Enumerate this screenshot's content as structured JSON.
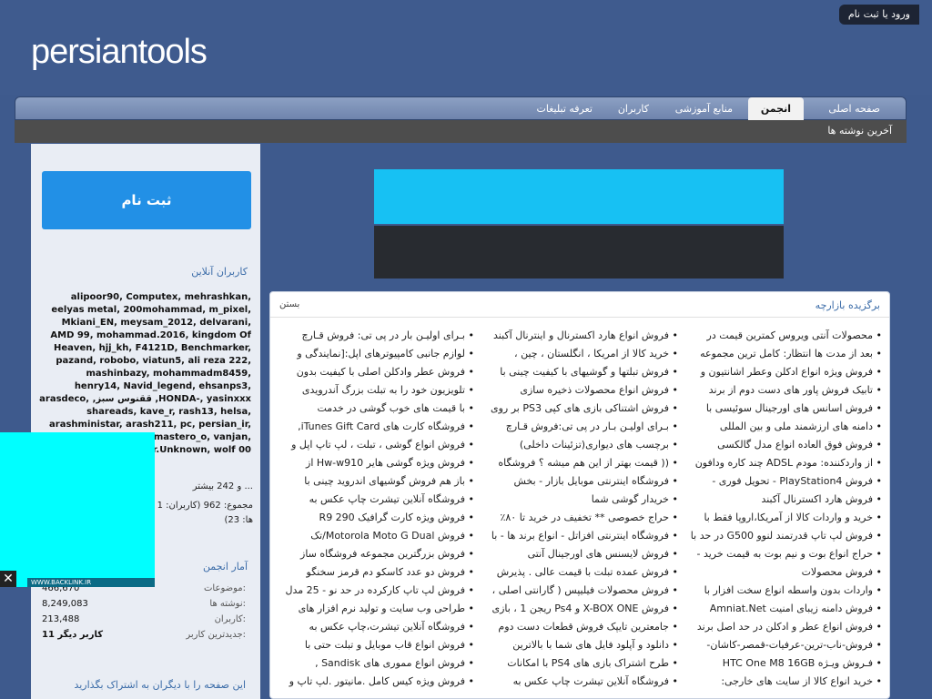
{
  "header": {
    "logo": "persiantools",
    "login": "ورود یا ثبت نام"
  },
  "nav": [
    {
      "label": "صفحه اصلی"
    },
    {
      "label": "انجمن"
    },
    {
      "label": "منابع آموزشی"
    },
    {
      "label": "کاربران"
    },
    {
      "label": "تعرفه تبلیغات"
    }
  ],
  "subnav": {
    "label": "آخرین نوشته ها"
  },
  "sidebar": {
    "register": "ثبت نام",
    "online_title": "کاربران آنلاین",
    "online_users": "alipoor90, Computex, mehrashkan, eelyas metal, 200mohammad, m_pixel, Mkiani_EN, meysam_2012, delvarani, AMD 99, mohammad.2016, kingdom Of Heaven, hjj_kh, F4121D, Benchmarker, pazand, robobo, viatun5, ali reza 222, mashinbazy, mohammadm8459, henry14, Navid_legend, ehsanps3, HONDA-, yasinxxx, ققنوس سبز, arasdeco, shareads, kave_r, rash13, helsa, arashministar, arash211, pc, persian_ir, ghr_a, ocks2015, mastero_o, vanjan, alipoursajjad, Mr.Unknown, wolf 00",
    "online_more": "... و 242 بیشتر",
    "online_total": "مجموع: 962 (کاربران: 1",
    "online_total2": "ها: 23)",
    "stats_title": "آمار انجمن",
    "stats": [
      {
        "label": "موضوعات:",
        "value": "466,670"
      },
      {
        "label": "نوشته ها:",
        "value": "8,249,083"
      },
      {
        "label": "کاربران:",
        "value": "213,488"
      },
      {
        "label": "جدیدترین کاربر:",
        "value": "11 کاربر دیگر"
      }
    ],
    "share": "این صفحه را با دیگران به اشتراک بگذارید"
  },
  "ad": {
    "url": "WWW.BACKLINK.IR"
  },
  "panel": {
    "title": "برگزیده بازارچه",
    "close": "بستن",
    "col1": [
      "محصولات آنتی ویروس کمترین قیمت در",
      "بعد از مدت ها انتظار: کامل ترین مجموعه",
      "فروش ویژه انواع ادکلن وعطر اشانتیون و",
      "تابیک فروش پاور های دست دوم از برند",
      "فروش اسانس های اورجینال سوئیسی با",
      "دامنه های ارزشمند ملی و بین المللی",
      "فروش فوق العاده انواع مدل گالکسی",
      "از واردکننده: مودم ADSL چند کاره ودافون",
      "فروش PlayStation4 - تحویل فوری -",
      "فروش هارد اکسترنال آکبند",
      "خرید و واردات کالا از آمریکا،اروپا فقط با",
      "فروش لپ تاپ قدرتمند لنوو G500 در حد با",
      "حراج انواع بوت و نیم بوت به قیمت خرید -",
      "فروش محصولات",
      "واردات بدون واسطه انواع سخت افزار با",
      "فروش دامنه زیبای امنیت Amniat.Net",
      "فروش انواع عطر و ادکلن در حد اصل برند",
      "فروش-ناب-ترین-عرفیات-قمصر-کاشان-",
      "فـروش ویـژه HTC One M8 16GB",
      "خرید انواع کالا از سایت های خارجی:"
    ],
    "col2": [
      "فروش انواع هارد اکسترنال و اینترنال آکبند",
      "خرید کالا از امریکا ، انگلستان ، چین ،",
      "فروش تبلتها و گوشیهای با کیفیت چینی با",
      "فروش انواع محصولات ذخیره سازی",
      "فروش اشتناکی بازی های کپی PS3 بر روی",
      "بـرای اولیـن بـار در پی تی:فروش قـارچ",
      "برچسب های دیواری(تزئینات داخلی)",
      "(( قیمت بهتر از این هم میشه ؟ فروشگاه",
      "فروشگاه اینترنتی موبایل بازار - بخش",
      "خریدار گوشی شما",
      "حراج خصوصی ** تخفیف در خرید تا ۸۰٪",
      "فروشگاه اینترنتی افزاتل - انواع برند ها - با",
      "فروش لایسنس های اورجینال آنتی",
      "فروش عمده تبلت با قیمت عالی . پذیرش",
      "فروش محصولات فیلیپس ( گارانتی اصلی ،",
      "فروش X-BOX ONE و Ps4 ریجن 1 ، بازی",
      "جامعترین تایپک فروش قطعات دست دوم",
      "دانلود و آپلود فایل های شما با بالاترین",
      "طرح اشتراک بازی های PS4 با امکانات",
      "فروشگاه آنلاین تیشرت چاپ عکس به"
    ],
    "col3": [
      "بـرای اولیـن بار در پی تی: فروش قـارچ",
      "لوازم جانبی کامپیوترهای اپل:[نمایندگی و",
      "فروش عطر وادکلن اصلی با کیفیت بدون",
      "تلویزیون خود را به تبلت بزرگ آندرویدی",
      "با قیمت های خوب گوشی در خدمت",
      "فروشگاه کارت های iTunes Gift Card,",
      "فروش انواع گوشی ، تبلت ، لپ تاپ اپل و",
      "فروش ویژه گوشی هایر Hw-w910 از",
      "باز هم فروش گوشیهای اندروید چینی با",
      "فروشگاه آنلاین تیشرت چاپ عکس به",
      "فروش ویژه کارت گرافیک R9 290",
      "فروش Motorola Moto G Dual/تک",
      "فروش بزرگترین مجموعه فروشگاه ساز",
      "فروش دو عدد کاسکو دم قرمز سخنگو",
      "فروش لپ تاپ کارکرده در حد نو - 25 مدل",
      "طراحی وب سایت و تولید نرم افزار های",
      "فروشگاه آنلاین تیشرت،چاپ عکس به",
      "فروش انواع قاب موبایل و تبلت حتی با",
      "فروش انواع مموری های Sandisk ,",
      "فروش ویژه کیس کامل .مانیتور .لپ تاپ و"
    ]
  }
}
